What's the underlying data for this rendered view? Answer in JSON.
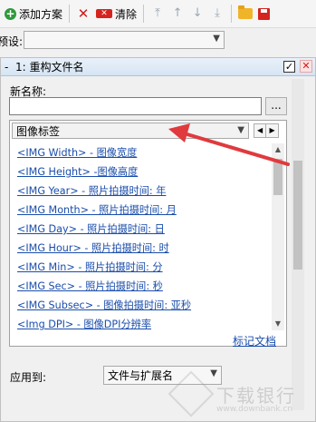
{
  "toolbar": {
    "add_label": "添加方案",
    "clear_label": "清除",
    "clear_icon_text": "✕",
    "icons": [
      "add-icon",
      "delete-icon",
      "clear-icon",
      "move-top-icon",
      "move-up-icon",
      "move-down-icon",
      "move-bottom-icon",
      "open-folder-icon",
      "save-icon"
    ]
  },
  "preset": {
    "label": "预设:",
    "value": ""
  },
  "panel": {
    "collapse_symbol": "-",
    "title": "1: 重构文件名",
    "checked": true,
    "new_name_label": "新名称:",
    "new_name_value": "",
    "browse_label": "...",
    "tag_category": "图像标签",
    "tags": [
      "<IMG Width> - 图像宽度",
      "<IMG Height> -图像高度",
      "<IMG Year>  - 照片拍摄时间: 年",
      "<IMG Month> - 照片拍摄时间: 月",
      "<IMG Day> - 照片拍摄时间: 日",
      "<IMG Hour> - 照片拍摄时间: 时",
      "<IMG Min> - 照片拍摄时间: 分",
      "<IMG Sec> - 照片拍摄时间: 秒",
      "<IMG Subsec> - 图像拍摄时间: 亚秒",
      "<Img DPI> - 图像DPI分辨率"
    ],
    "doc_link": "标记文档",
    "apply_label": "应用到:",
    "apply_value": "文件与扩展名"
  },
  "watermark": {
    "text": "下载银行",
    "sub": "www.downbank.cn"
  },
  "colors": {
    "link": "#1a4dab",
    "arrow": "#e03a3e",
    "header": "#d6e4f3"
  }
}
